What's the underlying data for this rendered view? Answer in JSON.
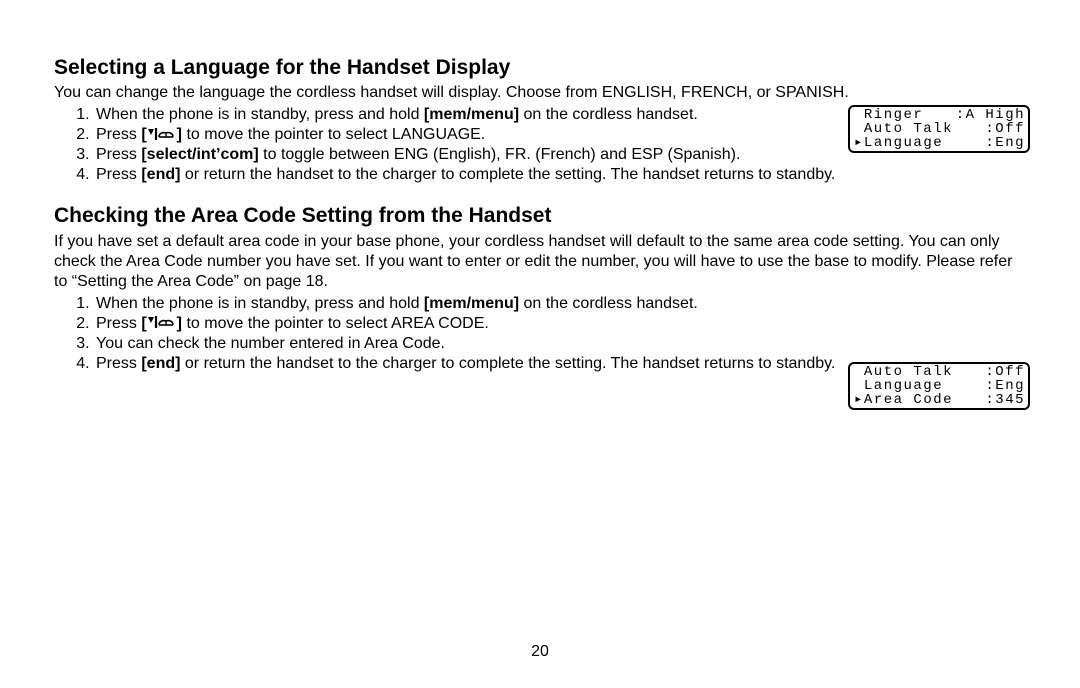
{
  "page_number": "20",
  "section1": {
    "heading": "Selecting a Language for the Handset Display",
    "intro": "You can change the language the cordless handset will display. Choose from ENGLISH, FRENCH, or SPANISH.",
    "step1_a": "When the phone is in standby, press and hold ",
    "step1_b": "[mem/menu]",
    "step1_c": " on the cordless handset.",
    "step2_a": "Press ",
    "step2_b": "[",
    "step2_c": "]",
    "step2_d": " to move the pointer to select LANGUAGE.",
    "step3_a": "Press ",
    "step3_b": "[select/int’com]",
    "step3_c": " to toggle between ENG (English), FR. (French) and ESP (Spanish).",
    "step4_a": "Press ",
    "step4_b": "[end]",
    "step4_c": " or return the handset to the charger to complete the setting. The handset returns to standby."
  },
  "section2": {
    "heading": "Checking the Area Code Setting from the Handset",
    "intro": "If you have set a default area code in your base phone, your cordless handset will default to the same area code setting. You can only check the Area Code number you have set. If you want to enter or edit the number, you will have to use the base to modify. Please refer to “Setting the Area Code” on page 18.",
    "step1_a": "When the phone is in standby, press and hold ",
    "step1_b": "[mem/menu]",
    "step1_c": " on the cordless handset.",
    "step2_a": "Press ",
    "step2_b": "[",
    "step2_c": "]",
    "step2_d": " to move the pointer to select AREA CODE.",
    "step3": "You can check the number entered in Area Code.",
    "step4_a": "Press ",
    "step4_b": "[end]",
    "step4_c": " or return the handset to the charger to complete the setting. The handset returns to standby."
  },
  "lcd1": {
    "r1l": " Ringer",
    "r1r": ":A High",
    "r2l": " Auto Talk",
    "r2r": ":Off",
    "r3l": "▸Language",
    "r3r": ":Eng"
  },
  "lcd2": {
    "r1l": " Auto Talk",
    "r1r": ":Off",
    "r2l": " Language",
    "r2r": ":Eng",
    "r3l": "▸Area Code",
    "r3r": ":345"
  }
}
